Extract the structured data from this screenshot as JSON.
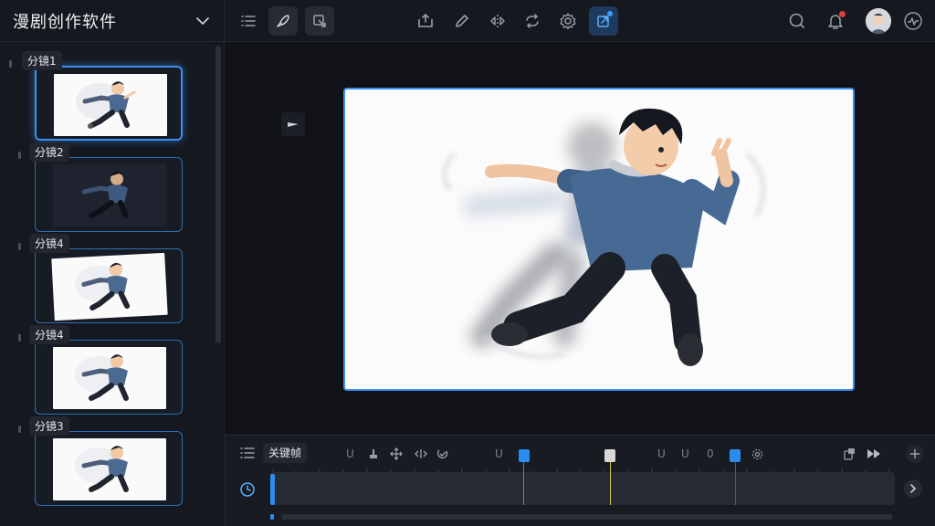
{
  "app": {
    "title": "漫剧创作软件"
  },
  "storyboard": {
    "items": [
      {
        "label": "分镜1",
        "active": true,
        "style": "light"
      },
      {
        "label": "分镜2",
        "active": false,
        "style": "dark"
      },
      {
        "label": "分镜4",
        "active": false,
        "style": "tilt"
      },
      {
        "label": "分镜4",
        "active": false,
        "style": "light"
      },
      {
        "label": "分镜3",
        "active": false,
        "style": "light"
      }
    ]
  },
  "toolbar": {
    "left_icons": [
      "list-icon",
      "brush-icon",
      "shape-icon"
    ],
    "center_icons": [
      "frame-add-icon",
      "pencil-icon",
      "flip-icon",
      "loop-icon",
      "gear-icon",
      "export-icon"
    ],
    "right_icons": [
      "search-icon",
      "bell-icon",
      "avatar",
      "pulse-icon"
    ]
  },
  "timeline": {
    "keyframe_label": "关键帧",
    "glyphs": {
      "g1": "U",
      "g2": "U",
      "g3": "U",
      "g4": "U",
      "g5": "0"
    },
    "keyframes": [
      {
        "color": "#2c8cf0"
      },
      {
        "color": "#d8d8d8"
      },
      {
        "color": "#2c8cf0"
      }
    ]
  },
  "colors": {
    "accent": "#3a8ff0",
    "playhead": "#e2c447",
    "notification": "#e23b3b"
  }
}
